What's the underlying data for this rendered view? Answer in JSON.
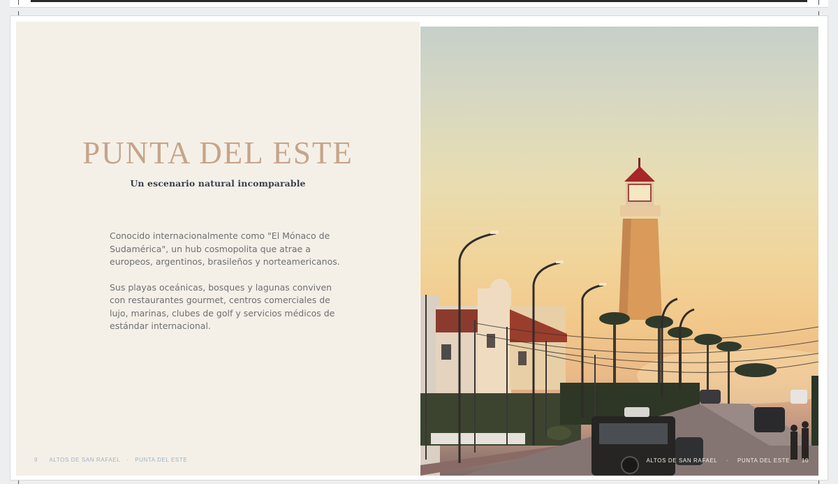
{
  "document": {
    "left_page": {
      "title": "PUNTA DEL ESTE",
      "subtitle": "Un escenario natural incomparable",
      "paragraphs": [
        "Conocido internacionalmente como \"El Mónaco de Sudamérica\", un hub cosmopolita que atrae a europeos, argentinos, brasileños y norteamericanos.",
        "Sus playas oceánicas, bosques y lagunas conviven con restaurantes gourmet, centros comerciales de lujo, marinas, clubes de golf y servicios médicos de estándar internacional."
      ],
      "footer": {
        "page_number": "9",
        "brand": "ALTOS DE SAN RAFAEL",
        "separator": "·",
        "section": "PUNTA DEL ESTE"
      }
    },
    "right_page": {
      "photo_subject": "lighthouse-street-sunset",
      "footer": {
        "brand": "ALTOS DE SAN RAFAEL",
        "separator": "·",
        "section": "PUNTA DEL ESTE",
        "page_number": "10"
      }
    },
    "colors": {
      "title": "#c6a489",
      "page_background": "#f4f0e8",
      "footer_left": "#9db3c2"
    }
  }
}
